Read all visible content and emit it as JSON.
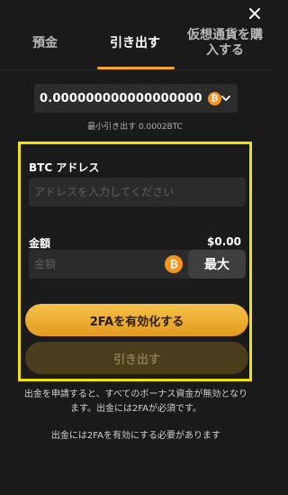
{
  "tabs": [
    {
      "label": "預金",
      "active": false
    },
    {
      "label": "引き出す",
      "active": true
    },
    {
      "label": "仮想通貨を購入する",
      "active": false
    }
  ],
  "currency": {
    "amount": "0.000000000000000000",
    "coin_symbol": "₿",
    "icon": "bitcoin-icon"
  },
  "min_withdraw": "最小引き出す 0.0002BTC",
  "address": {
    "label": "BTC アドレス",
    "placeholder": "アドレスを入力してください",
    "value": ""
  },
  "amount": {
    "label": "金額",
    "usd_value": "$0.00",
    "placeholder": "金額",
    "max_label": "最大"
  },
  "buttons": {
    "enable_2fa": "2FAを有効化する",
    "withdraw": "引き出す"
  },
  "notice": {
    "line1": "出金を申請すると、すべてのボーナス資金が無効となります。出金には2FAが必須です。",
    "line2": "出金には2FAを有効にする必要があります"
  },
  "colors": {
    "accent": "#f5a623",
    "highlight_border": "#f2e205",
    "bitcoin": "#f7931a"
  }
}
